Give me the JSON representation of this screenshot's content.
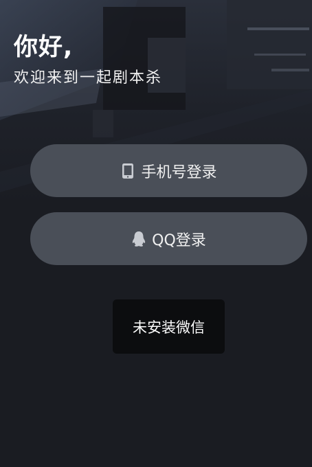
{
  "header": {
    "greeting": "你好,",
    "subtitle": "欢迎来到一起剧本杀"
  },
  "login": {
    "phone_label": "手机号登录",
    "phone_icon": "phone-icon",
    "qq_label": "QQ登录",
    "qq_icon": "qq-penguin-icon"
  },
  "toast": {
    "message": "未安装微信"
  },
  "colors": {
    "background": "#1a1c22",
    "button": "#4a4f58",
    "toast": "#0c0d0f"
  }
}
